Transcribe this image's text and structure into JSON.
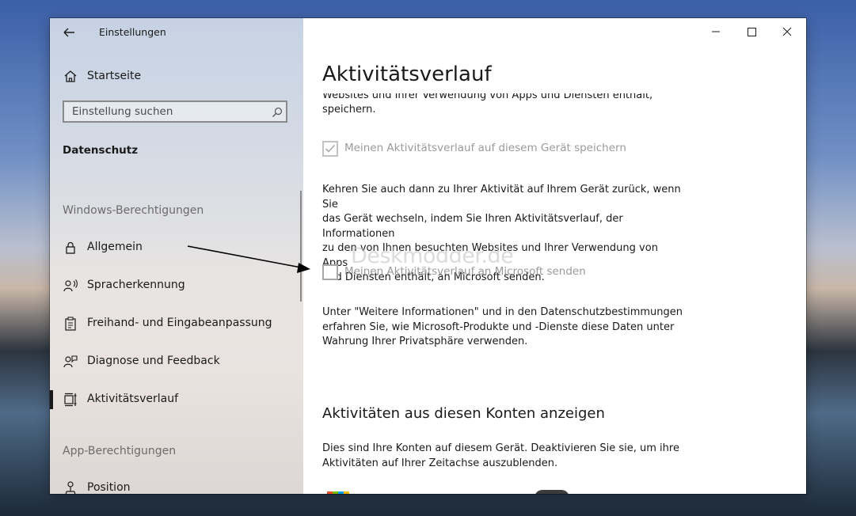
{
  "window": {
    "title": "Einstellungen",
    "controls": {
      "minimize": "minimize-icon",
      "maximize": "maximize-icon",
      "close": "close-icon"
    }
  },
  "sidebar": {
    "home_label": "Startseite",
    "search_placeholder": "Einstellung suchen",
    "category_title": "Datenschutz",
    "section_windows": "Windows-Berechtigungen",
    "items": [
      {
        "label": "Allgemein",
        "icon": "lock-icon"
      },
      {
        "label": "Spracherkennung",
        "icon": "speech-icon"
      },
      {
        "label": "Freihand- und Eingabeanpassung",
        "icon": "clipboard-icon"
      },
      {
        "label": "Diagnose und Feedback",
        "icon": "feedback-icon"
      },
      {
        "label": "Aktivitätsverlauf",
        "icon": "timeline-icon",
        "selected": true
      }
    ],
    "section_apps": "App-Berechtigungen",
    "app_items": [
      {
        "label": "Position",
        "icon": "location-icon"
      }
    ]
  },
  "main": {
    "page_title": "Aktivitätsverlauf",
    "intro_line1": "Websites und Ihrer Verwendung von Apps und Diensten enthält,",
    "intro_line2": "speichern.",
    "checkbox_store_label": "Meinen Aktivitätsverlauf auf diesem Gerät speichern",
    "checkbox_store_checked": true,
    "send_para": [
      "Kehren Sie auch dann zu Ihrer Aktivität auf Ihrem Gerät zurück, wenn Sie",
      "das Gerät wechseln, indem Sie Ihren Aktivitätsverlauf, der Informationen",
      "zu den von Ihnen besuchten Websites und Ihrer Verwendung von Apps",
      "und Diensten enthält, an Microsoft senden."
    ],
    "checkbox_send_label": "Meinen Aktivitätsverlauf an Microsoft senden",
    "checkbox_send_checked": false,
    "watermark": "Deskmodder.de",
    "info_para": [
      "Unter \"Weitere Informationen\" und in den Datenschutzbestimmungen",
      "erfahren Sie, wie Microsoft-Produkte und -Dienste diese Daten unter",
      "Wahrung Ihrer Privatsphäre verwenden."
    ],
    "accounts_heading": "Aktivitäten aus diesen Konten anzeigen",
    "accounts_para": [
      "Dies sind Ihre Konten auf diesem Gerät. Deaktivieren Sie sie, um ihre",
      "Aktivitäten auf Ihrer Zeitachse auszublenden."
    ]
  },
  "colors": {
    "accent": "#0078d7",
    "toggle_on": "#3c3c3c",
    "watermark": "#c8c8c8"
  }
}
